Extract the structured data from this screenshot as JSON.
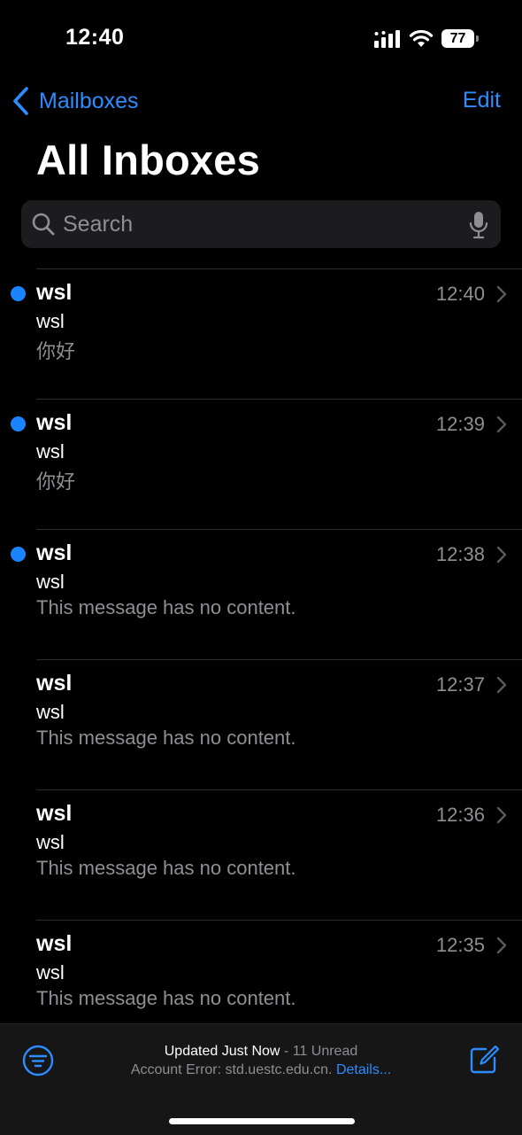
{
  "status_bar": {
    "time": "12:40",
    "battery": "77"
  },
  "nav": {
    "back_label": "Mailboxes",
    "edit_label": "Edit",
    "title": "All Inboxes"
  },
  "search": {
    "placeholder": "Search"
  },
  "messages": [
    {
      "sender": "wsl",
      "time": "12:40",
      "subject": "wsl",
      "preview": "你好",
      "unread": true
    },
    {
      "sender": "wsl",
      "time": "12:39",
      "subject": "wsl",
      "preview": "你好",
      "unread": true
    },
    {
      "sender": "wsl",
      "time": "12:38",
      "subject": "wsl",
      "preview": "This message has no content.",
      "unread": true
    },
    {
      "sender": "wsl",
      "time": "12:37",
      "subject": "wsl",
      "preview": "This message has no content.",
      "unread": false
    },
    {
      "sender": "wsl",
      "time": "12:36",
      "subject": "wsl",
      "preview": "This message has no content.",
      "unread": false
    },
    {
      "sender": "wsl",
      "time": "12:35",
      "subject": "wsl",
      "preview": "This message has no content.",
      "unread": false
    }
  ],
  "toolbar": {
    "updated": "Updated Just Now",
    "separator": " - ",
    "unread_count": "11 Unread",
    "account_error": "Account Error: std.uestc.edu.cn.",
    "details_link": "Details..."
  },
  "icons": {
    "back": "chevron-left-icon",
    "search": "magnifier-icon",
    "mic": "microphone-icon",
    "row": "chevron-right-icon",
    "filter": "filter-icon",
    "compose": "compose-icon"
  },
  "colors": {
    "accent": "#2d8cff",
    "unread_dot": "#1a84ff",
    "background": "#000000",
    "secondary_text": "#8e8e93"
  }
}
